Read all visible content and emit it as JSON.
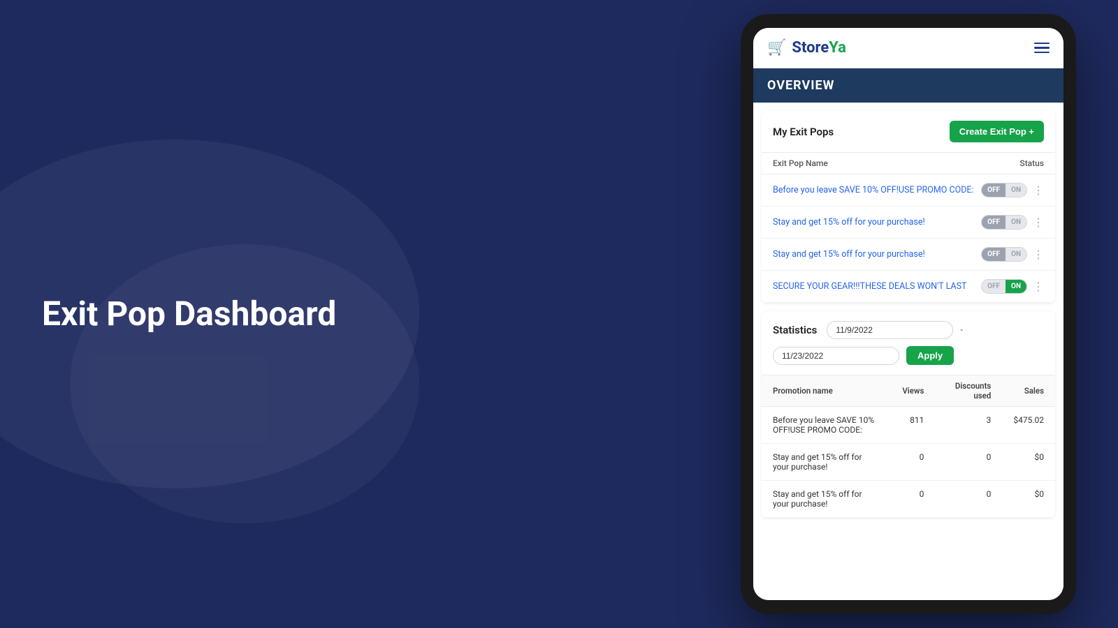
{
  "background": {
    "color": "#1e2a5e"
  },
  "left": {
    "title": "Exit Pop Dashboard"
  },
  "app": {
    "logo_store": "Store",
    "logo_ya": "Ya",
    "logo_cart": "🛒"
  },
  "overview": {
    "title": "OVERVIEW"
  },
  "exit_pops": {
    "section_title": "My Exit Pops",
    "create_button": "Create Exit Pop +",
    "col_name": "Exit Pop Name",
    "col_status": "Status",
    "items": [
      {
        "name": "Before you leave SAVE 10% OFF!USE PROMO CODE:",
        "status_off": "OFF",
        "status_on": "ON",
        "is_on": false
      },
      {
        "name": "Stay and get 15% off for your purchase!",
        "status_off": "OFF",
        "status_on": "ON",
        "is_on": false
      },
      {
        "name": "Stay and get 15% off for your purchase!",
        "status_off": "OFF",
        "status_on": "ON",
        "is_on": false
      },
      {
        "name": "SECURE YOUR GEAR!!!THESE DEALS WON'T LAST",
        "status_off": "OFF",
        "status_on": "ON",
        "is_on": true
      }
    ]
  },
  "statistics": {
    "title": "Statistics",
    "date_from": "11/9/2022",
    "date_to": "11/23/2022",
    "apply_button": "Apply",
    "date_separator": "-",
    "columns": {
      "promotion": "Promotion name",
      "views": "Views",
      "discounts": "Discounts used",
      "sales": "Sales"
    },
    "rows": [
      {
        "name": "Before you leave SAVE 10% OFF!USE PROMO CODE:",
        "views": "811",
        "discounts": "3",
        "sales": "$475.02"
      },
      {
        "name": "Stay and get 15% off for your purchase!",
        "views": "0",
        "discounts": "0",
        "sales": "$0"
      },
      {
        "name": "Stay and get 15% off for your purchase!",
        "views": "0",
        "discounts": "0",
        "sales": "$0"
      }
    ]
  }
}
